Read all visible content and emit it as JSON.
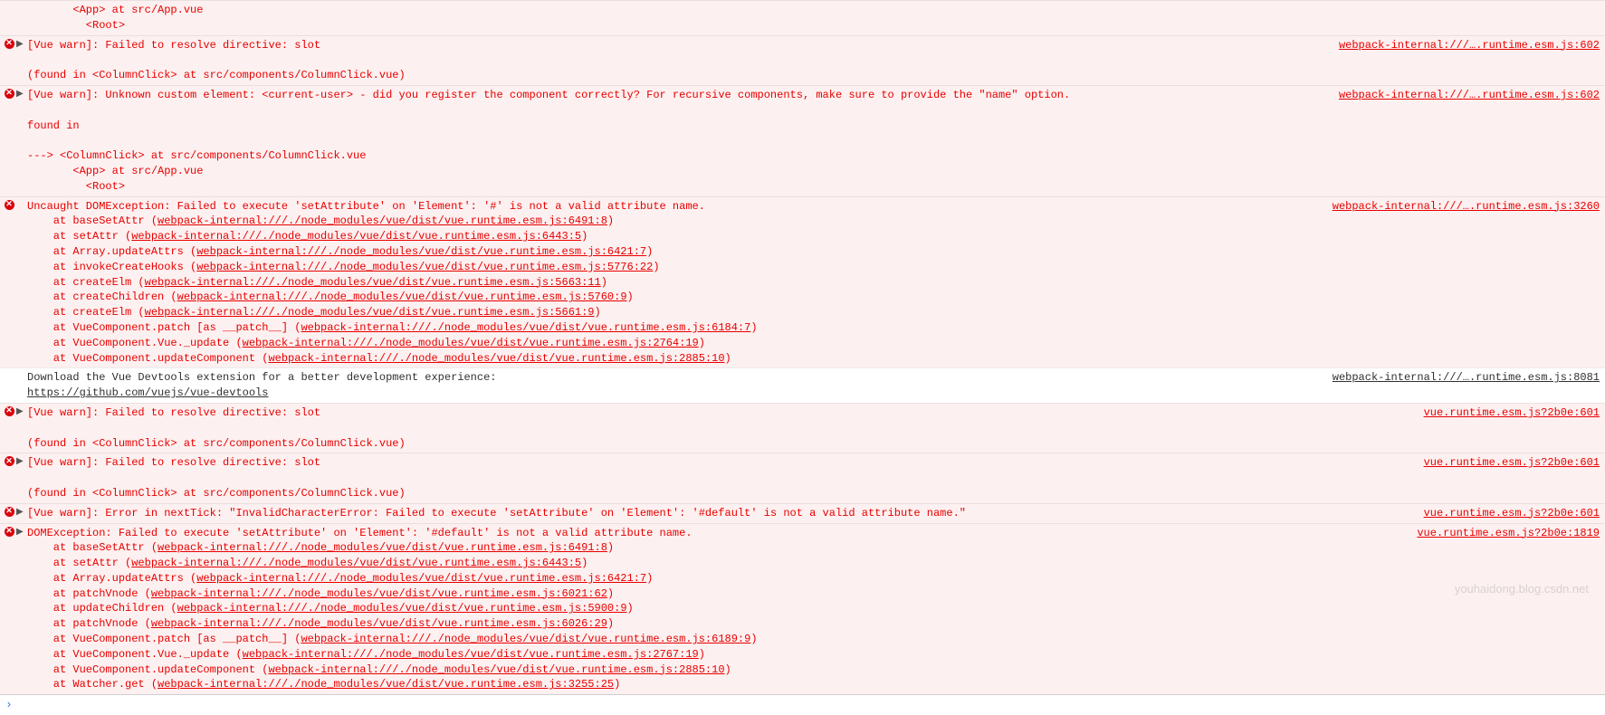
{
  "entries": [
    {
      "type": "error",
      "icon": false,
      "expander": false,
      "source": "",
      "msg": "       <App> at src/App.vue\n         <Root>"
    },
    {
      "type": "error",
      "icon": true,
      "expander": true,
      "source": "webpack-internal:///….runtime.esm.js:602",
      "msg": "[Vue warn]: Failed to resolve directive: slot\n\n(found in <ColumnClick> at src/components/ColumnClick.vue)"
    },
    {
      "type": "error",
      "icon": true,
      "expander": true,
      "source": "webpack-internal:///….runtime.esm.js:602",
      "msg": "[Vue warn]: Unknown custom element: <current-user> - did you register the component correctly? For recursive components, make sure to provide the \"name\" option.\n\nfound in\n\n---> <ColumnClick> at src/components/ColumnClick.vue\n       <App> at src/App.vue\n         <Root>"
    },
    {
      "type": "error",
      "icon": true,
      "expander": false,
      "source": "webpack-internal:///….runtime.esm.js:3260",
      "msg": "Uncaught DOMException: Failed to execute 'setAttribute' on 'Element': '#' is not a valid attribute name.",
      "stack": [
        {
          "fn": "at baseSetAttr",
          "loc": "webpack-internal:///./node_modules/vue/dist/vue.runtime.esm.js:6491:8"
        },
        {
          "fn": "at setAttr",
          "loc": "webpack-internal:///./node_modules/vue/dist/vue.runtime.esm.js:6443:5"
        },
        {
          "fn": "at Array.updateAttrs",
          "loc": "webpack-internal:///./node_modules/vue/dist/vue.runtime.esm.js:6421:7"
        },
        {
          "fn": "at invokeCreateHooks",
          "loc": "webpack-internal:///./node_modules/vue/dist/vue.runtime.esm.js:5776:22"
        },
        {
          "fn": "at createElm",
          "loc": "webpack-internal:///./node_modules/vue/dist/vue.runtime.esm.js:5663:11"
        },
        {
          "fn": "at createChildren",
          "loc": "webpack-internal:///./node_modules/vue/dist/vue.runtime.esm.js:5760:9"
        },
        {
          "fn": "at createElm",
          "loc": "webpack-internal:///./node_modules/vue/dist/vue.runtime.esm.js:5661:9"
        },
        {
          "fn": "at VueComponent.patch [as __patch__]",
          "loc": "webpack-internal:///./node_modules/vue/dist/vue.runtime.esm.js:6184:7"
        },
        {
          "fn": "at VueComponent.Vue._update",
          "loc": "webpack-internal:///./node_modules/vue/dist/vue.runtime.esm.js:2764:19"
        },
        {
          "fn": "at VueComponent.updateComponent",
          "loc": "webpack-internal:///./node_modules/vue/dist/vue.runtime.esm.js:2885:10"
        }
      ]
    },
    {
      "type": "info",
      "icon": false,
      "expander": false,
      "source": "webpack-internal:///….runtime.esm.js:8081",
      "msg": "Download the Vue Devtools extension for a better development experience:",
      "link": "https://github.com/vuejs/vue-devtools"
    },
    {
      "type": "error",
      "icon": true,
      "expander": true,
      "source": "vue.runtime.esm.js?2b0e:601",
      "msg": "[Vue warn]: Failed to resolve directive: slot\n\n(found in <ColumnClick> at src/components/ColumnClick.vue)"
    },
    {
      "type": "error",
      "icon": true,
      "expander": true,
      "source": "vue.runtime.esm.js?2b0e:601",
      "msg": "[Vue warn]: Failed to resolve directive: slot\n\n(found in <ColumnClick> at src/components/ColumnClick.vue)"
    },
    {
      "type": "error",
      "icon": true,
      "expander": true,
      "source": "vue.runtime.esm.js?2b0e:601",
      "msg": "[Vue warn]: Error in nextTick: \"InvalidCharacterError: Failed to execute 'setAttribute' on 'Element': '#default' is not a valid attribute name.\""
    },
    {
      "type": "error",
      "icon": true,
      "expander": true,
      "source": "vue.runtime.esm.js?2b0e:1819",
      "msg": "DOMException: Failed to execute 'setAttribute' on 'Element': '#default' is not a valid attribute name.",
      "stack": [
        {
          "fn": "at baseSetAttr",
          "loc": "webpack-internal:///./node_modules/vue/dist/vue.runtime.esm.js:6491:8"
        },
        {
          "fn": "at setAttr",
          "loc": "webpack-internal:///./node_modules/vue/dist/vue.runtime.esm.js:6443:5"
        },
        {
          "fn": "at Array.updateAttrs",
          "loc": "webpack-internal:///./node_modules/vue/dist/vue.runtime.esm.js:6421:7"
        },
        {
          "fn": "at patchVnode",
          "loc": "webpack-internal:///./node_modules/vue/dist/vue.runtime.esm.js:6021:62"
        },
        {
          "fn": "at updateChildren",
          "loc": "webpack-internal:///./node_modules/vue/dist/vue.runtime.esm.js:5900:9"
        },
        {
          "fn": "at patchVnode",
          "loc": "webpack-internal:///./node_modules/vue/dist/vue.runtime.esm.js:6026:29"
        },
        {
          "fn": "at VueComponent.patch [as __patch__]",
          "loc": "webpack-internal:///./node_modules/vue/dist/vue.runtime.esm.js:6189:9"
        },
        {
          "fn": "at VueComponent.Vue._update",
          "loc": "webpack-internal:///./node_modules/vue/dist/vue.runtime.esm.js:2767:19"
        },
        {
          "fn": "at VueComponent.updateComponent",
          "loc": "webpack-internal:///./node_modules/vue/dist/vue.runtime.esm.js:2885:10"
        },
        {
          "fn": "at Watcher.get",
          "loc": "webpack-internal:///./node_modules/vue/dist/vue.runtime.esm.js:3255:25"
        }
      ]
    }
  ],
  "prompt_symbol": "›",
  "watermark": "youhaidong.blog.csdn.net"
}
